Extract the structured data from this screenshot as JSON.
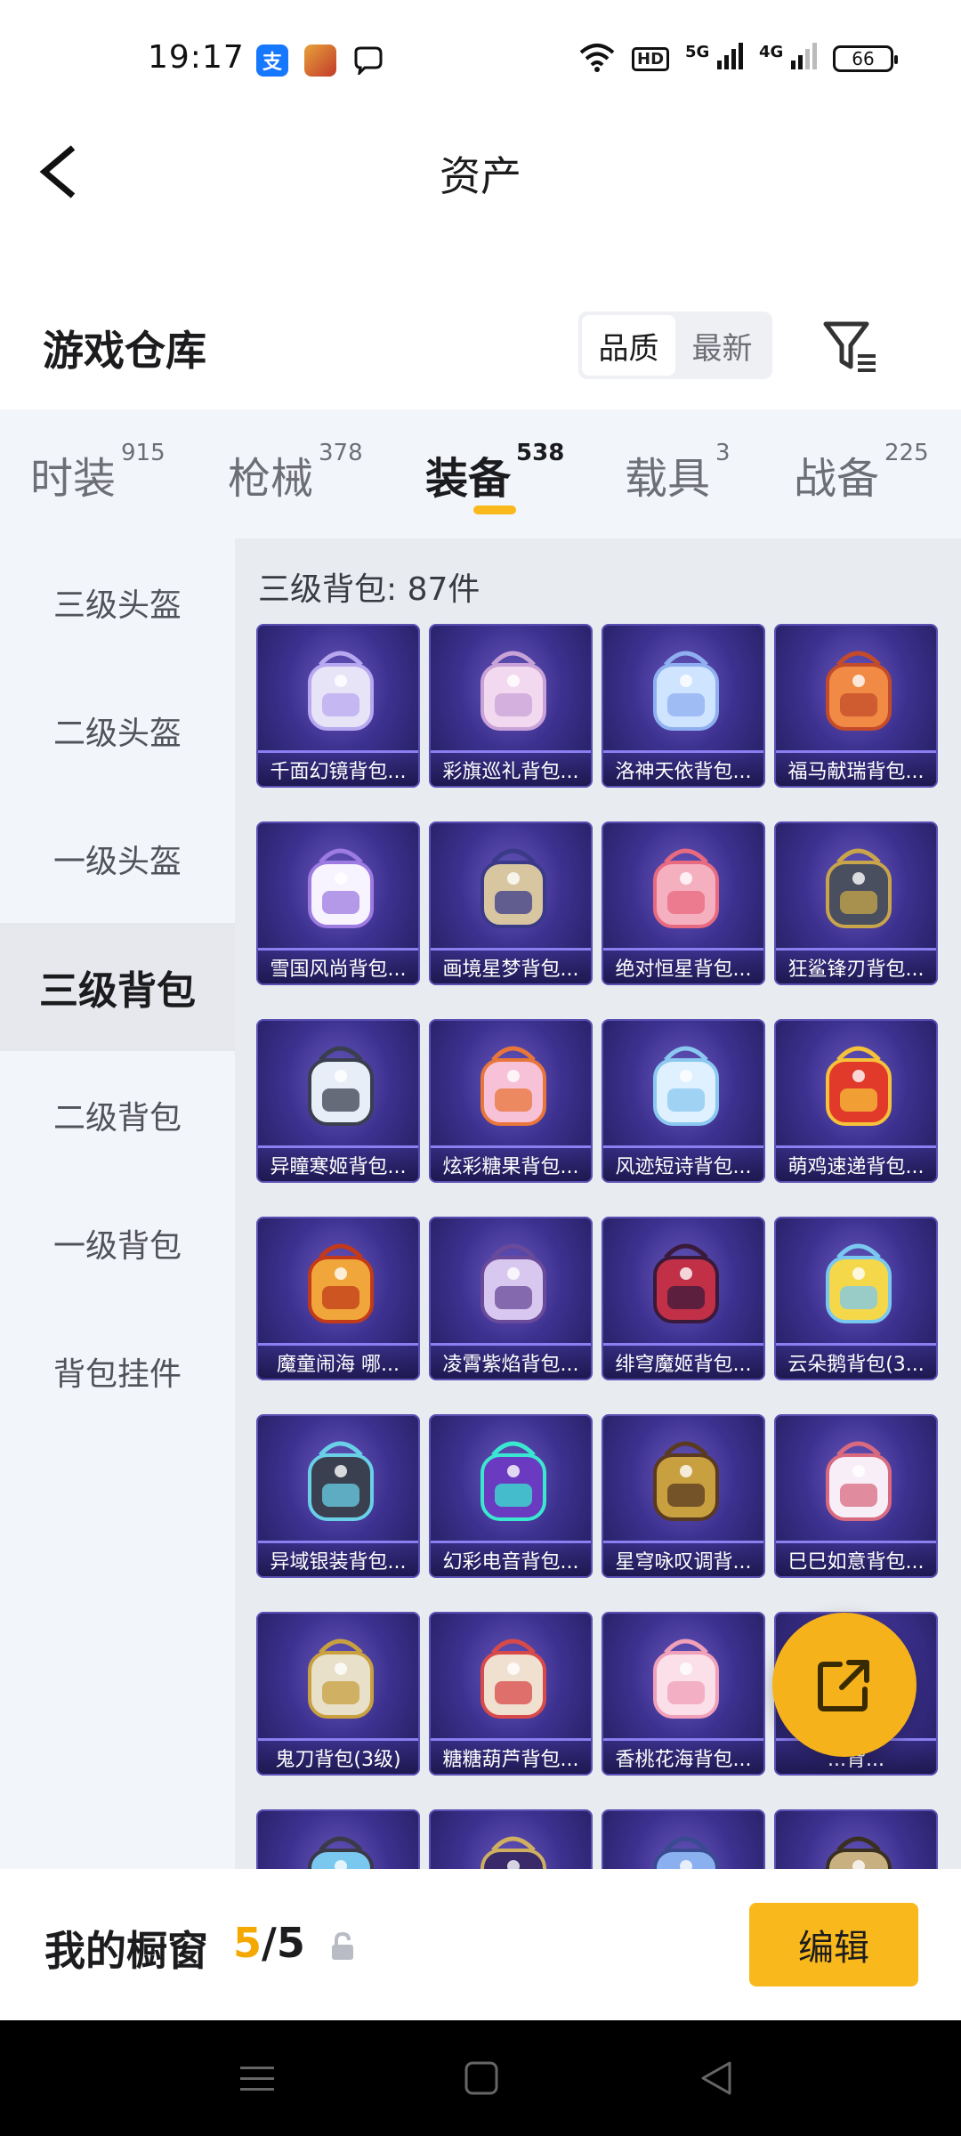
{
  "status_bar": {
    "time": "19:17",
    "network_labels": [
      "5G",
      "4G"
    ],
    "battery": "66"
  },
  "header": {
    "title": "资产"
  },
  "warehouse": {
    "title": "游戏仓库",
    "sort_options": [
      "品质",
      "最新"
    ],
    "selected_sort": "品质"
  },
  "tabs": [
    {
      "label": "时装",
      "count": "915"
    },
    {
      "label": "枪械",
      "count": "378"
    },
    {
      "label": "装备",
      "count": "538",
      "active": true
    },
    {
      "label": "载具",
      "count": "3"
    },
    {
      "label": "战备",
      "count": "225"
    }
  ],
  "sidebar": {
    "items": [
      "三级头盔",
      "二级头盔",
      "一级头盔",
      "三级背包",
      "二级背包",
      "一级背包",
      "背包挂件"
    ],
    "active": "三级背包"
  },
  "content": {
    "heading": "三级背包: 87件",
    "items": [
      "千面幻镜背包...",
      "彩旗巡礼背包...",
      "洛神天依背包...",
      "福马献瑞背包...",
      "雪国风尚背包...",
      "画境星梦背包...",
      "绝对恒星背包...",
      "狂鲨锋刃背包...",
      "异瞳寒姬背包...",
      "炫彩糖果背包...",
      "风迹短诗背包...",
      "萌鸡速递背包...",
      "魔童闹海 哪...",
      "凌霄紫焰背包...",
      "绯穹魔姬背包...",
      "云朵鹅背包(3...",
      "异域银装背包...",
      "幻彩电音背包...",
      "星穹咏叹调背...",
      "巳巳如意背包...",
      "鬼刀背包(3级)",
      "糖糖葫芦背包...",
      "香桃花海背包...",
      "...背..."
    ]
  },
  "bottom_bar": {
    "label": "我的橱窗",
    "current": "5",
    "separator": "/",
    "total": "5",
    "edit_label": "编辑"
  },
  "colors": {
    "accent": "#f9b81c",
    "card_bg": "#3d3190",
    "card_border": "#5a4fb3"
  }
}
